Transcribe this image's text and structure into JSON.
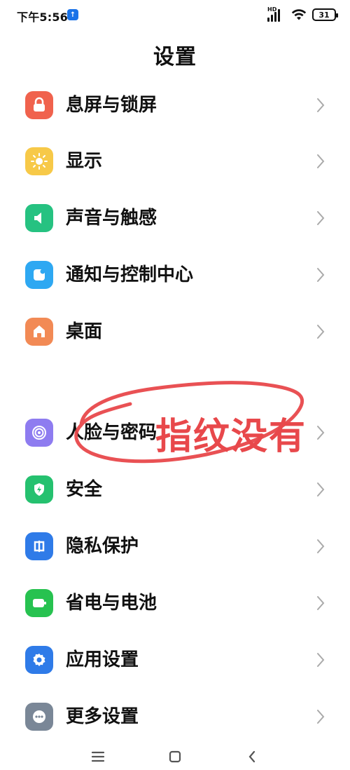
{
  "status_bar": {
    "time": "下午5:56",
    "network_label": "HD",
    "battery": "31"
  },
  "header": {
    "title": "设置"
  },
  "settings": {
    "items": [
      {
        "label": "息屏与锁屏",
        "icon": "lock-icon",
        "color": "#f0624d"
      },
      {
        "label": "显示",
        "icon": "sun-icon",
        "color": "#f7c948"
      },
      {
        "label": "声音与触感",
        "icon": "speaker-icon",
        "color": "#26c281"
      },
      {
        "label": "通知与控制中心",
        "icon": "notification-icon",
        "color": "#2ea8f2"
      },
      {
        "label": "桌面",
        "icon": "home-icon",
        "color": "#f28a55"
      },
      {
        "label": "人脸与密码",
        "icon": "face-password-icon",
        "color": "#8e7cf0"
      },
      {
        "label": "安全",
        "icon": "shield-bolt-icon",
        "color": "#25c16f"
      },
      {
        "label": "隐私保护",
        "icon": "privacy-icon",
        "color": "#2f7be8"
      },
      {
        "label": "省电与电池",
        "icon": "battery-icon",
        "color": "#27c250"
      },
      {
        "label": "应用设置",
        "icon": "gear-icon",
        "color": "#2f7be8"
      },
      {
        "label": "更多设置",
        "icon": "more-icon",
        "color": "#7a8797"
      }
    ]
  },
  "annotation": {
    "text": "指纹没有",
    "color": "#e8484b"
  },
  "navigation": {
    "menu_icon": "menu-icon",
    "home_icon": "home-square-icon",
    "back_icon": "back-icon"
  }
}
